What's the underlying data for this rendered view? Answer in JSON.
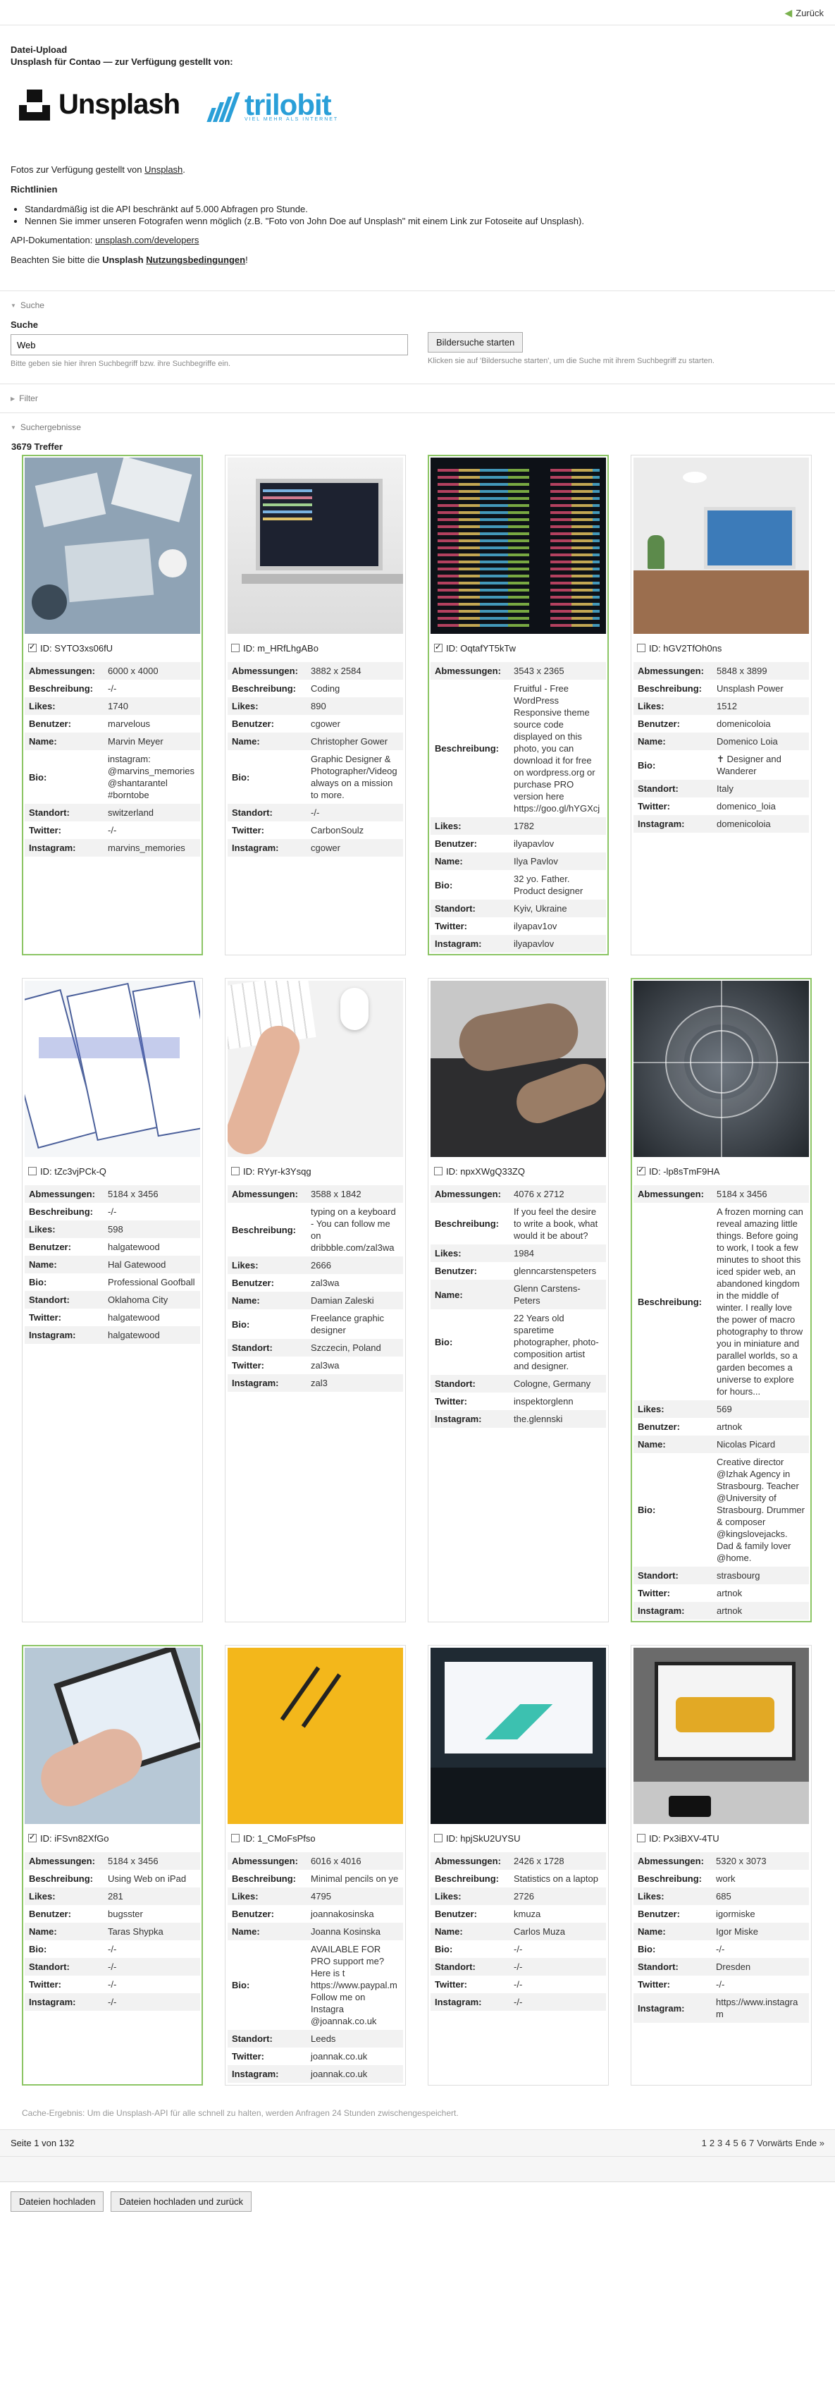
{
  "topbar": {
    "back_label": "Zurück"
  },
  "header": {
    "title": "Datei-Upload",
    "subtitle": "Unsplash für Contao — zur Verfügung gestellt von:",
    "unsplash_word": "Unsplash",
    "trilobit_word": "trilobit",
    "trilobit_tag": "VIEL MEHR ALS INTERNET"
  },
  "info": {
    "provided_by": "Fotos zur Verfügung gestellt von",
    "provided_link": "Unsplash",
    "guidelines_title": "Richtlinien",
    "rules": [
      "Standardmäßig ist die API beschränkt auf 5.000 Abfragen pro Stunde.",
      "Nennen Sie immer unseren Fotografen wenn möglich (z.B. \"Foto von John Doe auf Unsplash\" mit einem Link zur Fotoseite auf Unsplash)."
    ],
    "api_doc_label": "API-Dokumentation:",
    "api_doc_link": "unsplash.com/developers",
    "terms_prefix": "Beachten Sie bitte die",
    "terms_bold": "Unsplash",
    "terms_link": "Nutzungsbedingungen",
    "terms_suffix": "!"
  },
  "search": {
    "legend": "Suche",
    "label": "Suche",
    "value": "Web",
    "hint": "Bitte geben sie hier ihren Suchbegriff bzw. ihre Suchbegriffe ein.",
    "button": "Bildersuche starten",
    "button_hint": "Klicken sie auf 'Bildersuche starten', um die Suche mit ihrem Suchbegriff zu starten."
  },
  "filter": {
    "legend": "Filter"
  },
  "results": {
    "legend": "Suchergebnisse",
    "count": "3679 Treffer",
    "labels": {
      "dim": "Abmessungen:",
      "desc": "Beschreibung:",
      "likes": "Likes:",
      "user": "Benutzer:",
      "name": "Name:",
      "bio": "Bio:",
      "loc": "Standort:",
      "tw": "Twitter:",
      "ig": "Instagram:"
    },
    "items": [
      {
        "id": "ID: SYTO3xs06fU",
        "checked": true,
        "dim": "6000 x 4000",
        "desc": "-/-",
        "likes": "1740",
        "user": "marvelous",
        "name": "Marvin Meyer",
        "bio": "instagram: @marvins_memories @shantarantel #borntobe",
        "loc": "switzerland",
        "tw": "-/-",
        "ig": "marvins_memories",
        "img": "desk"
      },
      {
        "id": "ID: m_HRfLhgABo",
        "checked": false,
        "dim": "3882 x 2584",
        "desc": "Coding",
        "likes": "890",
        "user": "cgower",
        "name": "Christopher Gower",
        "bio": "Graphic Designer & Photographer/Videog always on a mission to more.",
        "loc": "-/-",
        "tw": "CarbonSoulz",
        "ig": "cgower",
        "img": "macbook"
      },
      {
        "id": "ID: OqtafYT5kTw",
        "checked": true,
        "dim": "3543 x 2365",
        "desc": "Fruitful - Free WordPress Responsive theme source code displayed on this photo, you can download it for free on wordpress.org or purchase PRO version here https://goo.gl/hYGXcj",
        "likes": "1782",
        "user": "ilyapavlov",
        "name": "Ilya Pavlov",
        "bio": "32 yo. Father. Product designer",
        "loc": "Kyiv, Ukraine",
        "tw": "ilyapav1ov",
        "ig": "ilyapavlov",
        "img": "code"
      },
      {
        "id": "ID: hGV2TfOh0ns",
        "checked": false,
        "dim": "5848 x 3899",
        "desc": "Unsplash Power",
        "likes": "1512",
        "user": "domenicoloia",
        "name": "Domenico Loia",
        "bio": "✝ Designer and Wanderer",
        "loc": "Italy",
        "tw": "domenico_loia",
        "ig": "domenicoloia",
        "img": "laptoproom"
      },
      {
        "id": "ID: tZc3vjPCk-Q",
        "checked": false,
        "dim": "5184 x 3456",
        "desc": "-/-",
        "likes": "598",
        "user": "halgatewood",
        "name": "Hal Gatewood",
        "bio": "Professional Goofball",
        "loc": "Oklahoma City",
        "tw": "halgatewood",
        "ig": "halgatewood",
        "img": "sketch"
      },
      {
        "id": "ID: RYyr-k3Ysqg",
        "checked": false,
        "dim": "3588 x 1842",
        "desc": "typing on a keyboard - You can follow me on dribbble.com/zal3wa",
        "likes": "2666",
        "user": "zal3wa",
        "name": "Damian Zaleski",
        "bio": "Freelance graphic designer",
        "loc": "Szczecin, Poland",
        "tw": "zal3wa",
        "ig": "zal3",
        "img": "keyboard"
      },
      {
        "id": "ID: npxXWgQ33ZQ",
        "checked": false,
        "dim": "4076 x 2712",
        "desc": "If you feel the desire to write a book, what would it be about?",
        "likes": "1984",
        "user": "glenncarstenspeters",
        "name": "Glenn Carstens-Peters",
        "bio": "22 Years old sparetime photographer, photo-composition artist and designer.",
        "loc": "Cologne, Germany",
        "tw": "inspektorglenn",
        "ig": "the.glennski",
        "img": "typing"
      },
      {
        "id": "ID: -lp8sTmF9HA",
        "checked": true,
        "dim": "5184 x 3456",
        "desc": "A frozen morning can reveal amazing little things. Before going to work, I took a few minutes to shoot this iced spider web, an abandoned kingdom in the middle of winter. I really love the power of macro photography to throw you in miniature and parallel worlds, so a garden becomes a universe to explore for hours...",
        "likes": "569",
        "user": "artnok",
        "name": "Nicolas Picard",
        "bio": "Creative director @Izhak Agency in Strasbourg. Teacher @University of Strasbourg. Drummer & composer @kingslovejacks. Dad & family lover @home.",
        "loc": "strasbourg",
        "tw": "artnok",
        "ig": "artnok",
        "img": "web"
      },
      {
        "id": "ID: iFSvn82XfGo",
        "checked": true,
        "dim": "5184 x 3456",
        "desc": "Using Web on iPad",
        "likes": "281",
        "user": "bugsster",
        "name": "Taras Shypka",
        "bio": "-/-",
        "loc": "-/-",
        "tw": "-/-",
        "ig": "-/-",
        "img": "ipad"
      },
      {
        "id": "ID: 1_CMoFsPfso",
        "checked": false,
        "dim": "6016 x 4016",
        "desc": "Minimal pencils on ye",
        "likes": "4795",
        "user": "joannakosinska",
        "name": "Joanna Kosinska",
        "bio": "AVAILABLE FOR PRO support me? Here is t https://www.paypal.m Follow me on Instagra @joannak.co.uk",
        "loc": "Leeds",
        "tw": "joannak.co.uk",
        "ig": "joannak.co.uk",
        "img": "yellow"
      },
      {
        "id": "ID: hpjSkU2UYSU",
        "checked": false,
        "dim": "2426 x 1728",
        "desc": "Statistics on a laptop",
        "likes": "2726",
        "user": "kmuza",
        "name": "Carlos Muza",
        "bio": "-/-",
        "loc": "-/-",
        "tw": "-/-",
        "ig": "-/-",
        "img": "stats"
      },
      {
        "id": "ID: Px3iBXV-4TU",
        "checked": false,
        "dim": "5320 x 3073",
        "desc": "work",
        "likes": "685",
        "user": "igormiske",
        "name": "Igor Miske",
        "bio": "-/-",
        "loc": "Dresden",
        "tw": "-/-",
        "ig": "https://www.instagram",
        "img": "sofa"
      }
    ]
  },
  "cache_note": "Cache-Ergebnis: Um die Unsplash-API für alle schnell zu halten, werden Anfragen 24 Stunden zwischengespeichert.",
  "pager": {
    "status": "Seite 1 von 132",
    "pages": [
      "1",
      "2",
      "3",
      "4",
      "5",
      "6",
      "7"
    ],
    "next": "Vorwärts",
    "last": "Ende »"
  },
  "footer": {
    "upload": "Dateien hochladen",
    "upload_back": "Dateien hochladen und zurück"
  }
}
